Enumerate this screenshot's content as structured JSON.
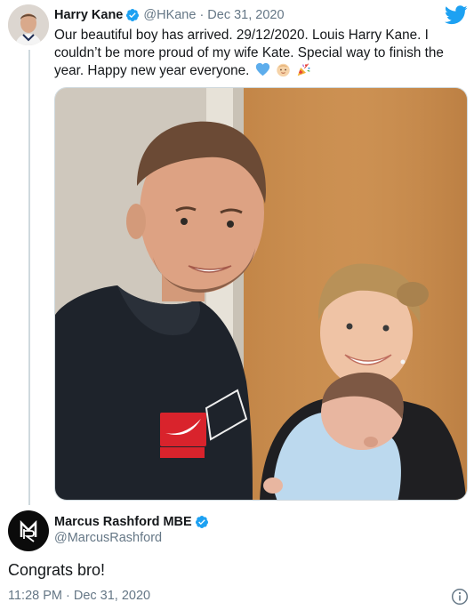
{
  "tweet": {
    "author_name": "Harry Kane",
    "author_handle": "@HKane",
    "separator": "·",
    "date": "Dec 31, 2020",
    "text": "Our beautiful boy has arrived. 29/12/2020. Louis Harry Kane. I couldn’t be more proud of my wife Kate. Special way to finish the year. Happy new year everyone.",
    "emojis": [
      "blue-heart-icon",
      "baby-icon",
      "party-popper-icon"
    ]
  },
  "reply": {
    "author_name": "Marcus Rashford MBE",
    "author_handle": "@MarcusRashford",
    "text": "Congrats bro!",
    "time": "11:28 PM",
    "separator": "·",
    "date": "Dec 31, 2020"
  },
  "colors": {
    "verified": "#1da1f2",
    "twitter_blue": "#1da1f2",
    "muted": "#657786",
    "text": "#14171a"
  },
  "icons": [
    "twitter-bird-icon",
    "verified-badge-icon",
    "info-icon"
  ]
}
